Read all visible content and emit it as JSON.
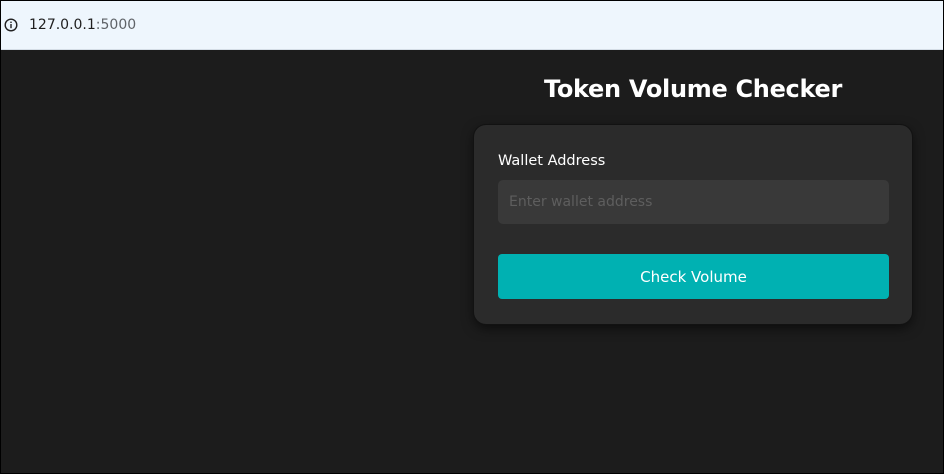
{
  "browser": {
    "url_host": "127.0.0.1",
    "url_port": ":5000",
    "info_icon": "info-icon"
  },
  "page": {
    "title": "Token Volume Checker",
    "background_color": "#1c1c1c"
  },
  "form": {
    "wallet_label": "Wallet Address",
    "wallet_placeholder": "Enter wallet address",
    "wallet_value": "",
    "submit_label": "Check Volume",
    "accent_color": "#00b1b2"
  }
}
